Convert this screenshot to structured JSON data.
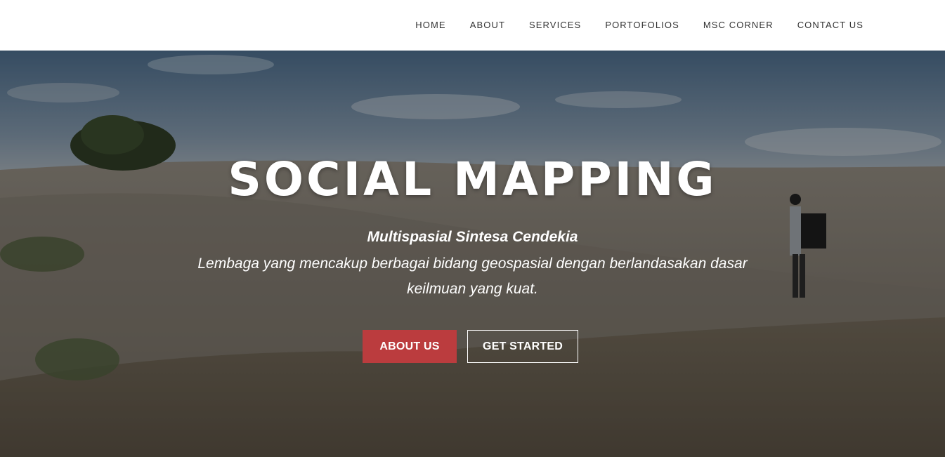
{
  "nav": {
    "items": [
      {
        "label": "HOME"
      },
      {
        "label": "ABOUT"
      },
      {
        "label": "SERVICES"
      },
      {
        "label": "PORTOFOLIOS"
      },
      {
        "label": "MSC CORNER"
      },
      {
        "label": "CONTACT US"
      }
    ]
  },
  "hero": {
    "title": "SOCIAL MAPPING",
    "subtitle": "Multispasial Sintesa Cendekia",
    "description": "Lembaga yang mencakup berbagai bidang geospasial dengan berlandasakan dasar keilmuan yang kuat.",
    "primary_button": "ABOUT US",
    "secondary_button": "GET STARTED"
  },
  "colors": {
    "accent": "#bb3c3e",
    "nav_text": "#333333",
    "nav_background": "#ffffff",
    "hero_text": "#ffffff"
  }
}
